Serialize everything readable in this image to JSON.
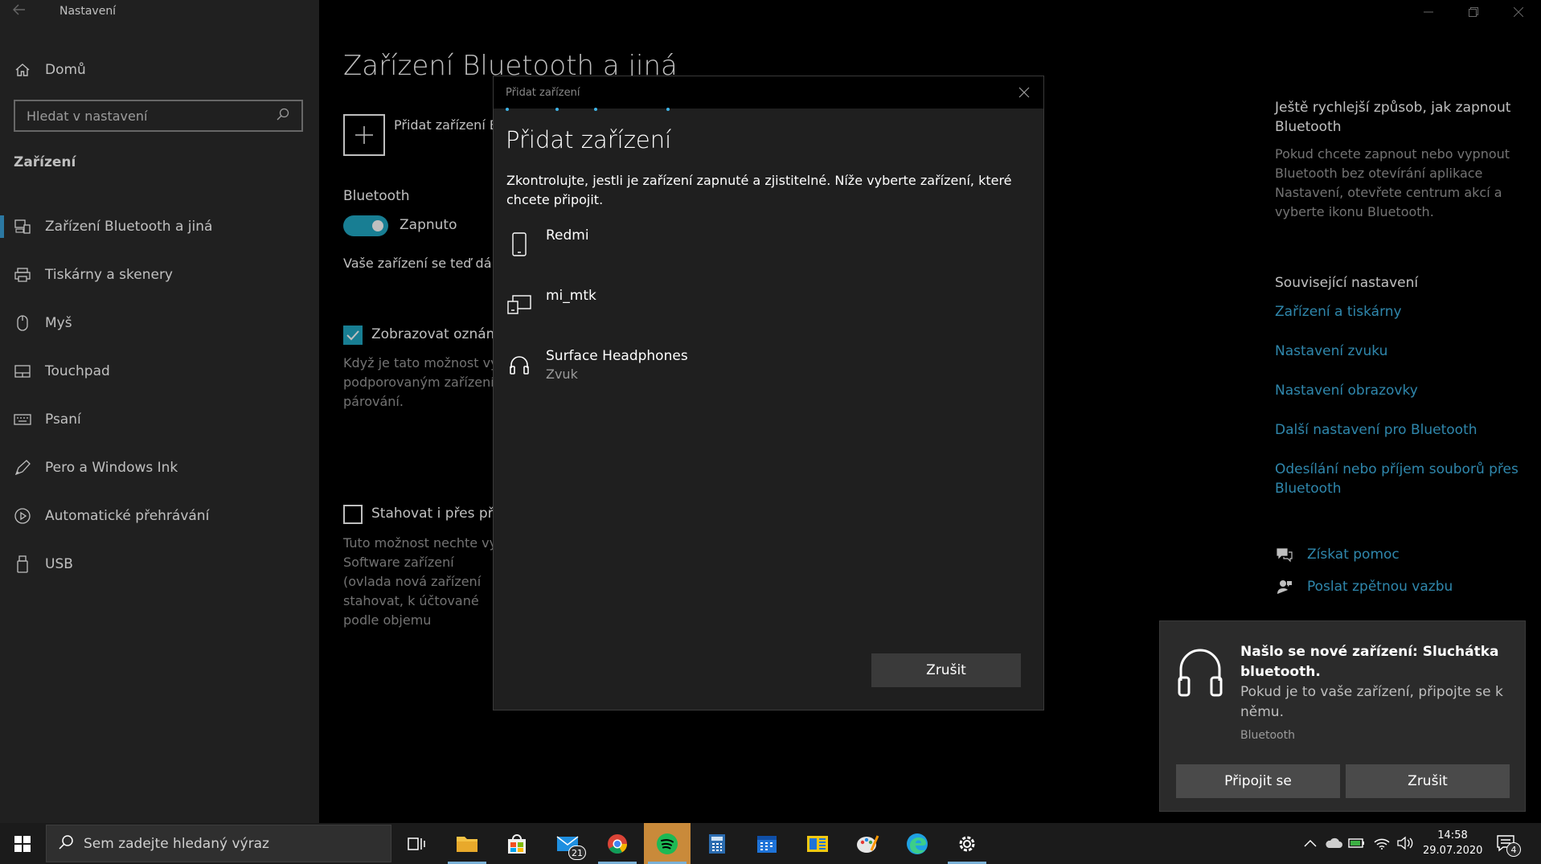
{
  "window": {
    "title": "Nastavení",
    "back_icon": "back-arrow-icon"
  },
  "sidebar": {
    "home_label": "Domů",
    "search_placeholder": "Hledat v nastavení",
    "section": "Zařízení",
    "items": [
      {
        "label": "Zařízení Bluetooth a jiná",
        "icon": "bluetooth-devices-icon",
        "active": true
      },
      {
        "label": "Tiskárny a skenery",
        "icon": "printer-icon"
      },
      {
        "label": "Myš",
        "icon": "mouse-icon"
      },
      {
        "label": "Touchpad",
        "icon": "touchpad-icon"
      },
      {
        "label": "Psaní",
        "icon": "keyboard-icon"
      },
      {
        "label": "Pero a Windows Ink",
        "icon": "pen-icon"
      },
      {
        "label": "Automatické přehrávání",
        "icon": "autoplay-icon"
      },
      {
        "label": "USB",
        "icon": "usb-icon"
      }
    ]
  },
  "main": {
    "title": "Zařízení Bluetooth a jiná",
    "add_label": "Přidat zařízení B",
    "bluetooth_label": "Bluetooth",
    "toggle_label": "Zapnuto",
    "discover_text": "Vaše zařízení se teď dá z",
    "check1_label": "Zobrazovat oznáme",
    "check1_desc": "Když je tato možnost vyl podporovaným zařízení párování.",
    "check2_label": "Stahovat i přes připo",
    "check2_desc": "Tuto možnost nechte vy Software zařízení (ovlada nová zařízení stahovat, k účtované podle objemu"
  },
  "right_pane": {
    "heading": "Ještě rychlejší způsob, jak zapnout Bluetooth",
    "body": "Pokud chcete zapnout nebo vypnout Bluetooth bez otevírání aplikace Nastavení, otevřete centrum akcí a vyberte ikonu Bluetooth.",
    "related_heading": "Související nastavení",
    "links": [
      "Zařízení a tiskárny",
      "Nastavení zvuku",
      "Nastavení obrazovky",
      "Další nastavení pro Bluetooth",
      "Odesílání nebo příjem souborů přes Bluetooth"
    ],
    "help_label": "Získat pomoc",
    "feedback_label": "Poslat zpětnou vazbu"
  },
  "dialog": {
    "titlebar": "Přidat zařízení",
    "heading": "Přidat zařízení",
    "description": "Zkontrolujte, jestli je zařízení zapnuté a zjistitelné. Níže vyberte zařízení, které chcete připojit.",
    "devices": [
      {
        "name": "Redmi",
        "sub": "",
        "icon": "phone-icon"
      },
      {
        "name": "mi_mtk",
        "sub": "",
        "icon": "display-device-icon"
      },
      {
        "name": "Surface Headphones",
        "sub": "Zvuk",
        "icon": "headphones-icon"
      }
    ],
    "cancel_label": "Zrušit"
  },
  "toast": {
    "title": "Našlo se nové zařízení: Sluchátka bluetooth.",
    "body": "Pokud je to vaše zařízení, připojte se k němu.",
    "app": "Bluetooth",
    "connect_label": "Připojit se",
    "cancel_label": "Zrušit"
  },
  "taskbar": {
    "search_placeholder": "Sem zadejte hledaný výraz",
    "mail_badge": "21",
    "time": "14:58",
    "date": "29.07.2020",
    "notification_count": "4"
  },
  "colors": {
    "accent": "#21a8c5",
    "link": "#3fb4e6",
    "sidebar_bg": "#2b2b2b",
    "dialog_bg": "#1f1f1f"
  }
}
